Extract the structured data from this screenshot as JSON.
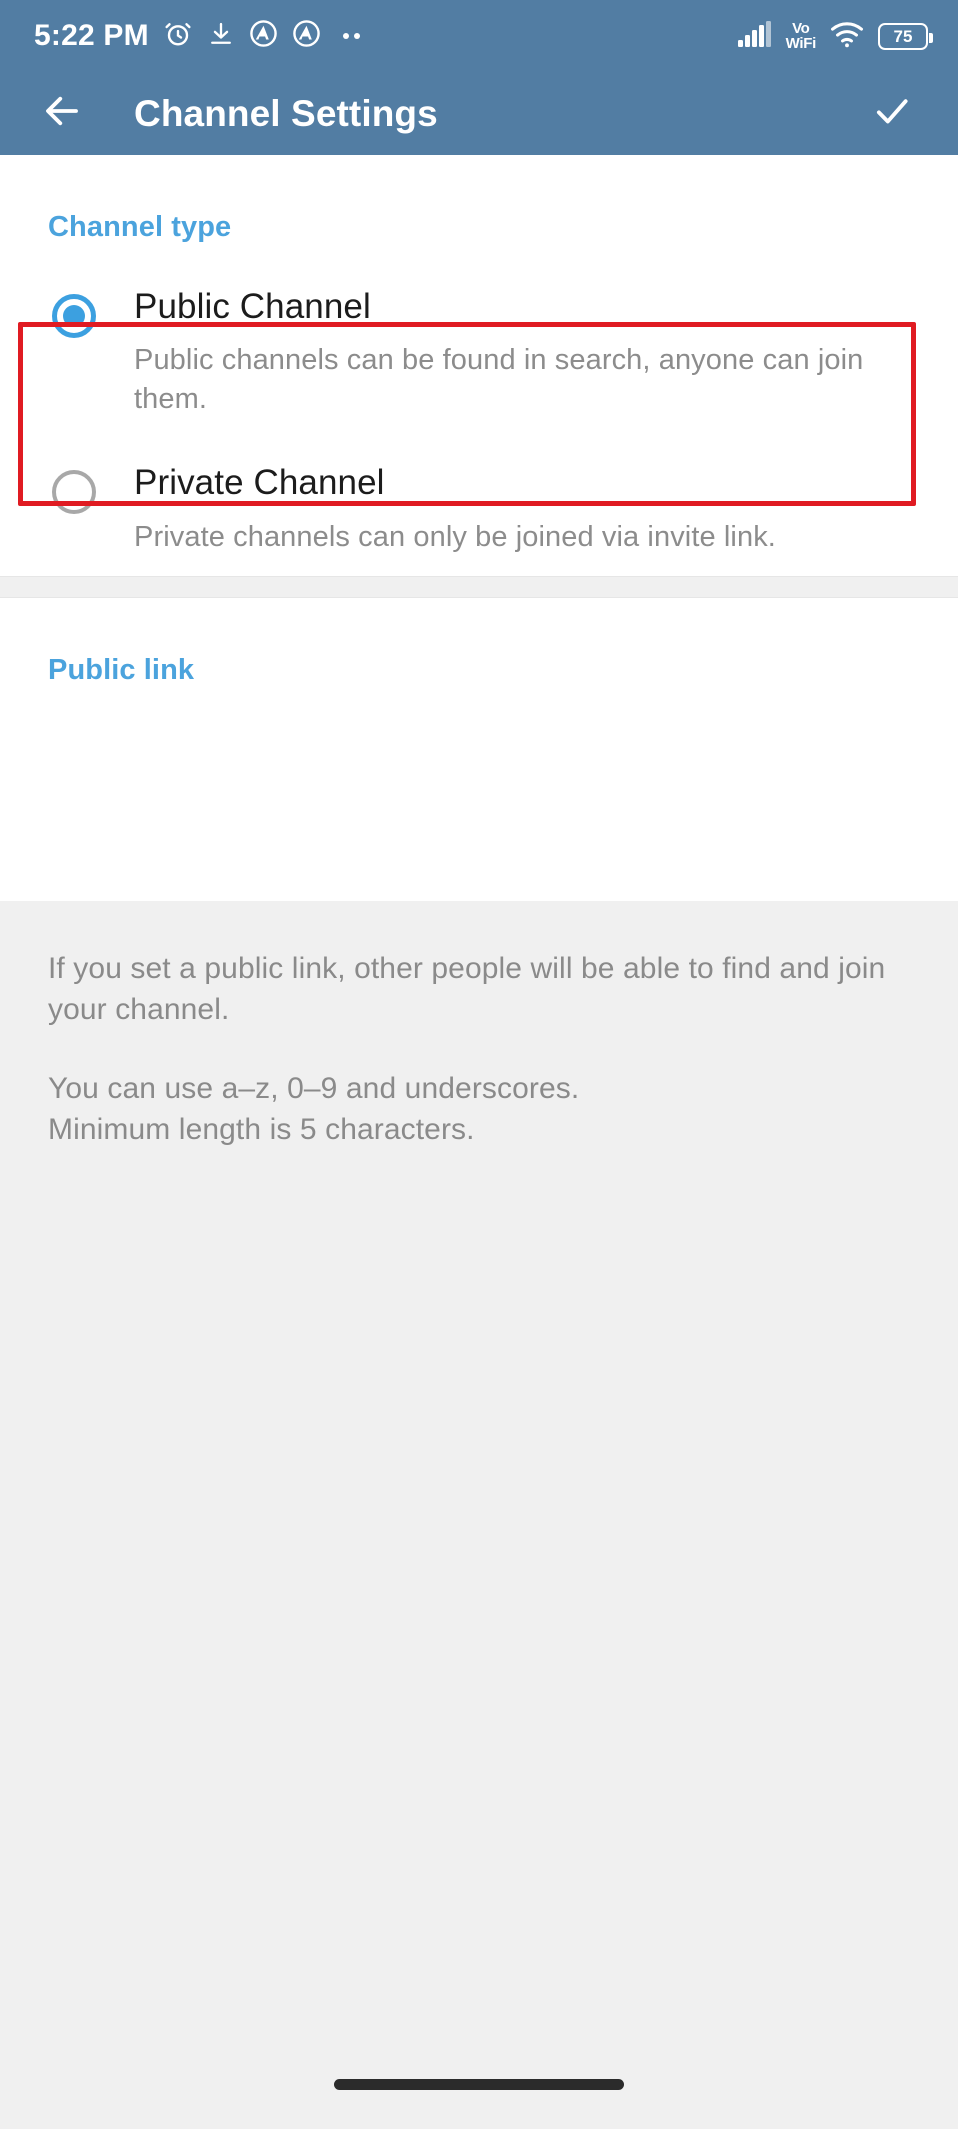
{
  "status_bar": {
    "time": "5:22 PM",
    "left_icons": [
      "alarm-clock-icon",
      "download-icon",
      "app-badge-a-icon",
      "app-badge-a-icon",
      "more-dots-icon"
    ],
    "signal_icon": "cellular-signal-icon",
    "vowifi_line1": "Vo",
    "vowifi_line2": "WiFi",
    "wifi_icon": "wifi-icon",
    "battery_level": "75"
  },
  "toolbar": {
    "back_icon": "back-arrow-icon",
    "title": "Channel Settings",
    "done_icon": "checkmark-icon"
  },
  "channel_type": {
    "section_title": "Channel type",
    "options": [
      {
        "title": "Public Channel",
        "description": "Public channels can be found in search, anyone can join them.",
        "selected": true
      },
      {
        "title": "Private Channel",
        "description": "Private channels can only be joined via invite link.",
        "selected": false
      }
    ]
  },
  "public_link": {
    "section_title": "Public link",
    "input_value": "",
    "input_placeholder": ""
  },
  "hints": [
    "If you set a public link, other people will be able to find and join your channel.",
    "You can use a–z, 0–9 and underscores.\nMinimum length is 5 characters."
  ],
  "colors": {
    "toolbar_blue": "#527da3",
    "accent_blue": "#4ba3dd",
    "radio_selected": "#3ca0e0",
    "highlight_red": "#e01b22",
    "page_bg": "#f0f0f0",
    "card_bg": "#ffffff",
    "primary_text": "#1c1c1c",
    "secondary_text": "#8a8a8a"
  },
  "nav": {
    "gesture_bar": "home-gesture-bar"
  }
}
